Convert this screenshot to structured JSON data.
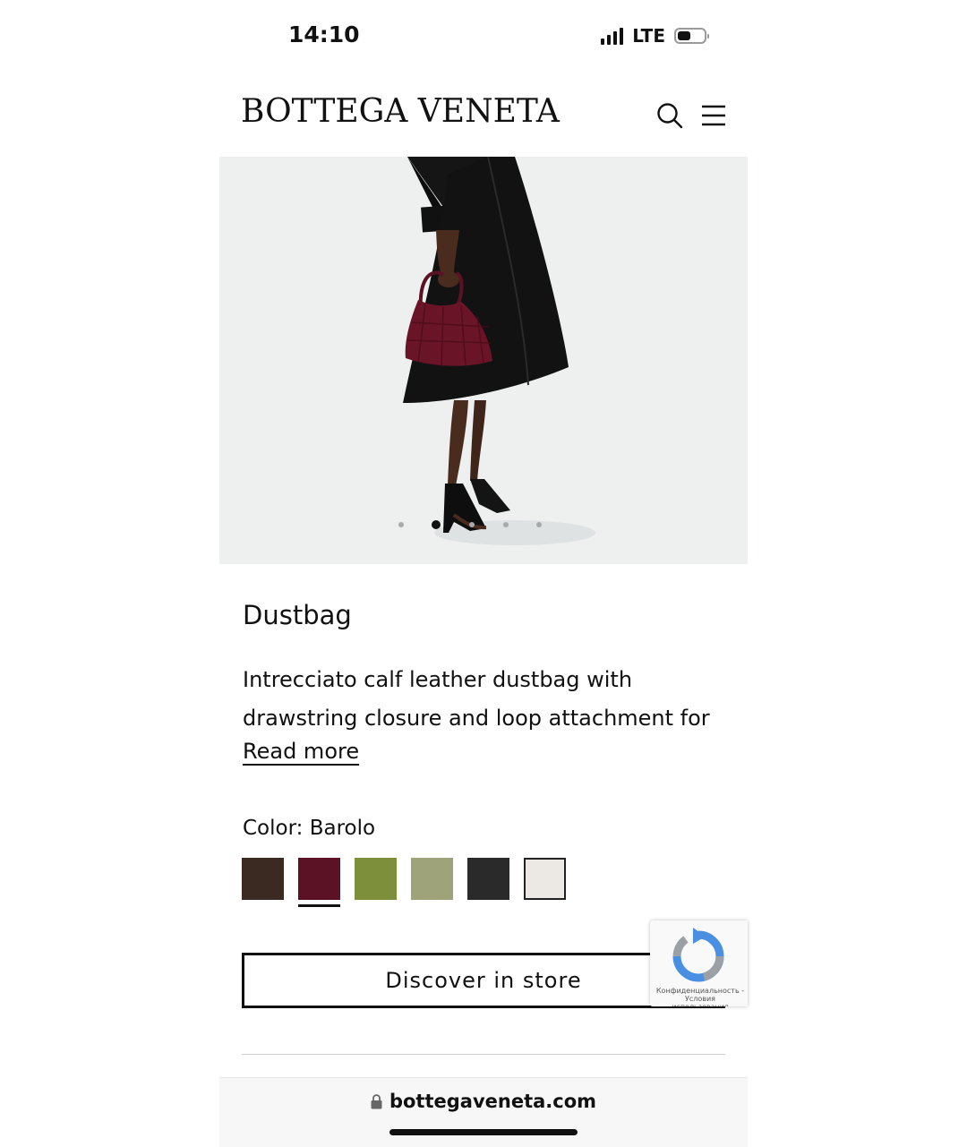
{
  "status_bar": {
    "time": "14:10",
    "network": "LTE",
    "icons": [
      "signal-icon",
      "battery-icon"
    ]
  },
  "header": {
    "logo": "BOTTEGA VENETA",
    "icons": [
      "search-icon",
      "menu-icon"
    ]
  },
  "gallery": {
    "image_alt": "Model in black coat holding Barolo intrecciato dustbag",
    "slide_count": 5,
    "active_slide": 2
  },
  "product": {
    "title": "Dustbag",
    "description": "Intrecciato calf leather dustbag with drawstring closure and loop attachment for",
    "read_more": "Read more",
    "color_label": "Color:",
    "color_value": "Barolo",
    "swatches": [
      {
        "color": "#3b2a22",
        "selected": false
      },
      {
        "color": "#5b1224",
        "selected": true
      },
      {
        "color": "#7d8f3a",
        "selected": false
      },
      {
        "color": "#9ea37a",
        "selected": false
      },
      {
        "color": "#2a2a2a",
        "selected": false
      },
      {
        "color": "#ece9e4",
        "selected": false
      }
    ],
    "store_button": "Discover in store"
  },
  "recaptcha": {
    "line1": "Конфиденциальность -",
    "line2": "Условия использования"
  },
  "browser": {
    "url": "bottegaveneta.com",
    "icons": [
      "lock-icon"
    ]
  }
}
